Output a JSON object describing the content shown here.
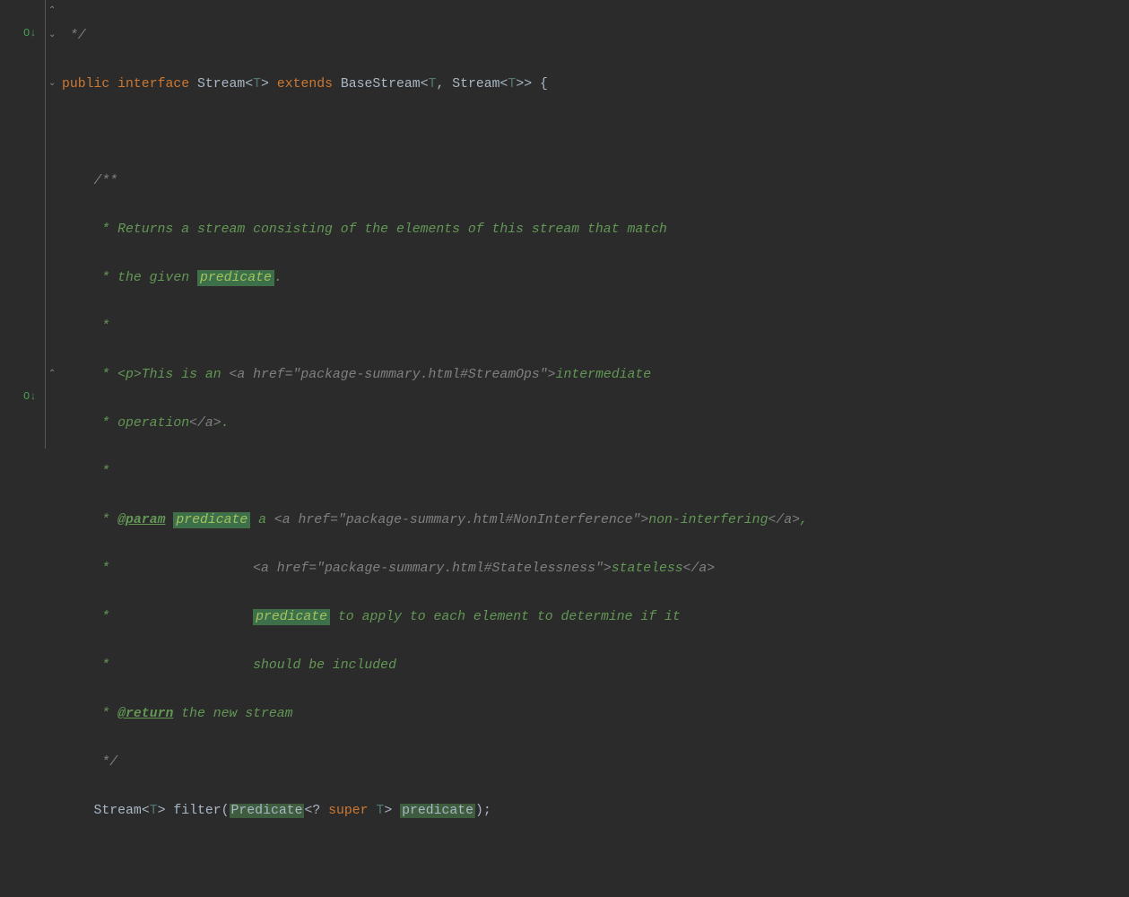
{
  "code": {
    "l0": " */",
    "l1_public": "public",
    "l1_interface": "interface",
    "l1_stream": "Stream",
    "l1_lt1": "<",
    "l1_T1": "T",
    "l1_gt1": ">",
    "l1_extends": "extends",
    "l1_base": "BaseStream",
    "l1_lt2": "<",
    "l1_T2": "T",
    "l1_comma": ",",
    "l1_stream2": "Stream",
    "l1_lt3": "<",
    "l1_T3": "T",
    "l1_gt3": ">>",
    "l1_brace": "{",
    "l3": "    /**",
    "l4": "     * Returns a stream consisting of the elements of this stream that match",
    "l5a": "     * the given ",
    "l5b": "predicate",
    "l5c": ".",
    "l6": "     *",
    "l7a": "     * <p>This is an ",
    "l7b": "<a href=\"package-summary.html#StreamOps\">",
    "l7c": "intermediate",
    "l8a": "     * operation",
    "l8b": "</a>",
    "l8c": ".",
    "l9": "     *",
    "l10a": "     * ",
    "l10b": "@param",
    "l10c": " ",
    "l10d": "predicate",
    "l10e": " a ",
    "l10f": "<a href=\"package-summary.html#NonInterference\">",
    "l10g": "non-interfering",
    "l10h": "</a>",
    "l10i": ",",
    "l11a": "     *                  ",
    "l11b": "<a href=\"package-summary.html#Statelessness\">",
    "l11c": "stateless",
    "l11d": "</a>",
    "l12a": "     *                  ",
    "l12b": "predicate",
    "l12c": " to apply to each element to determine if it",
    "l13": "     *                  should be included",
    "l14a": "     * ",
    "l14b": "@return",
    "l14c": " the new stream",
    "l15": "     */",
    "l16_stream": "Stream",
    "l16_lt": "<",
    "l16_T": "T",
    "l16_gt": ">",
    "l16_filter": "filter",
    "l16_lp": "(",
    "l16_pred": "Predicate",
    "l16_lt2": "<",
    "l16_q": "?",
    "l16_super": "super",
    "l16_T2": "T",
    "l16_gt2": ">",
    "l16_param": "predicate",
    "l16_rp": ")",
    "l16_sc": ";"
  },
  "icons": {
    "override1": "O↓",
    "override2": "O↓"
  }
}
